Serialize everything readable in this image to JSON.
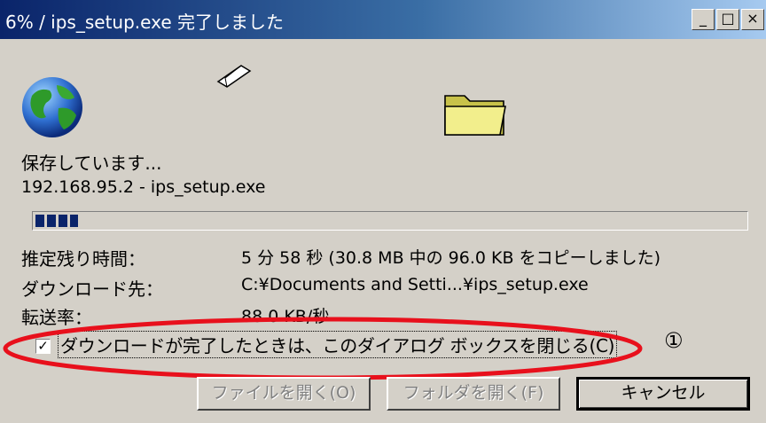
{
  "window": {
    "title": "6% / ips_setup.exe 完了しました",
    "minimize_glyph": "_",
    "maximize_glyph": "□",
    "close_glyph": "×"
  },
  "status": {
    "saving_text": "保存しています...",
    "source_line": "192.168.95.2 - ips_setup.exe"
  },
  "progress": {
    "fraction": 0.06
  },
  "details": {
    "remaining_label": "推定残り時間：",
    "remaining_value": "5 分 58 秒 (30.8 MB 中の 96.0 KB をコピーしました)",
    "dest_label": "ダウンロード先：",
    "dest_value": "C:¥Documents and Setti...¥ips_setup.exe",
    "rate_label": "転送率：",
    "rate_value": "88.0 KB/秒"
  },
  "close_on_complete": {
    "checked": true,
    "check_glyph": "✓",
    "label": "ダウンロードが完了したときは、このダイアログ ボックスを閉じる(C)"
  },
  "annotation": {
    "marker": "①",
    "color": "#e8101c"
  },
  "buttons": {
    "open_file": "ファイルを開く(O)",
    "open_folder": "フォルダを開く(F)",
    "cancel": "キャンセル"
  },
  "icons": {
    "globe": "globe-icon",
    "paper": "paper-icon",
    "folder": "folder-icon"
  },
  "colors": {
    "titlebar": "#0a246a",
    "dialog_bg": "#d4d0c8",
    "progress": "#0a246a"
  }
}
